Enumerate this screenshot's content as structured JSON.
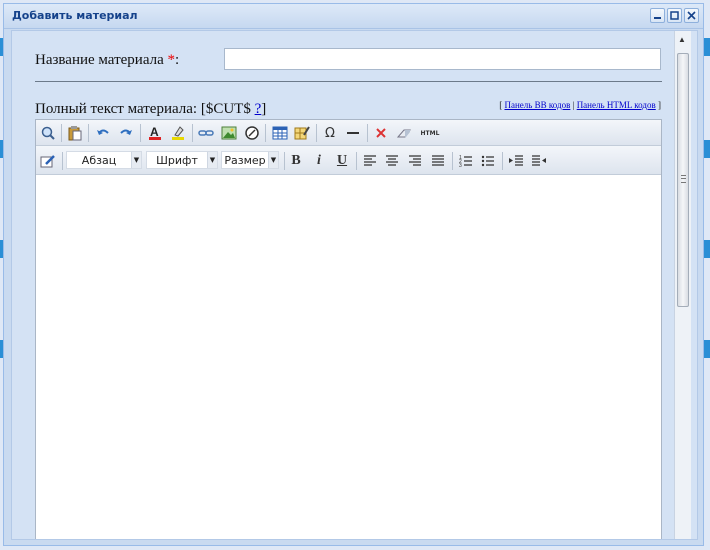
{
  "window": {
    "title": "Добавить материал",
    "controls": [
      "minimize-icon",
      "maximize-icon",
      "close-icon"
    ]
  },
  "form": {
    "title_label": "Название материала ",
    "title_required": "*",
    "title_colon": ":",
    "title_value": "",
    "fulltext_label": "Полный текст материала: [$CUT$ ",
    "fulltext_help": "?",
    "fulltext_close": "]",
    "panel_links": {
      "open": "[ ",
      "bb": "Панель BB кодов",
      "sep": " | ",
      "html": "Панель HTML кодов",
      "close": " ]"
    }
  },
  "editor": {
    "toolbar1": [
      "preview-icon",
      "paste-icon",
      "undo-icon",
      "redo-icon",
      "text-color-icon",
      "highlight-color-icon",
      "link-icon",
      "image-icon",
      "flash-icon",
      "table-icon",
      "cell-properties-icon",
      "special-char-icon",
      "horizontal-rule-icon",
      "remove-format-icon",
      "eraser-icon",
      "html-mode-icon"
    ],
    "special_char_glyph": "Ω",
    "html_glyph": "HTML",
    "format_select": "Абзац",
    "font_select": "Шрифт",
    "size_select": "Размер",
    "bold": "B",
    "italic": "i",
    "underline": "U",
    "content": "",
    "accent_color": "#15428b",
    "required_color": "#ee0000"
  }
}
